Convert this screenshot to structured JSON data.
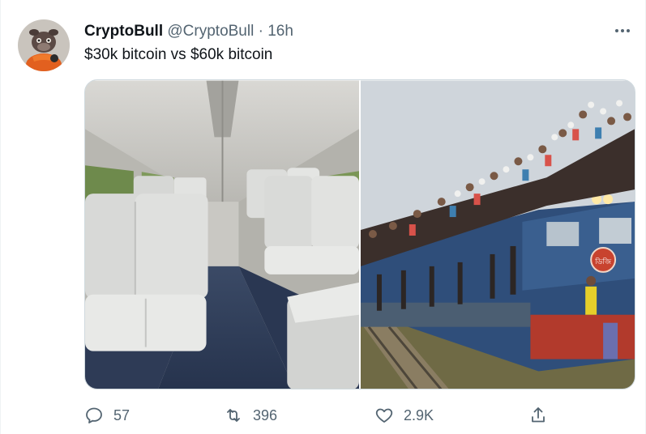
{
  "tweet": {
    "author_name": "CryptoBull",
    "author_handle": "@CryptoBull",
    "separator": "·",
    "time": "16h",
    "text": "$30k bitcoin vs $60k bitcoin"
  },
  "media": {
    "left_image": "empty-train-interior",
    "right_image": "overcrowded-train-with-people-on-roof",
    "train_badge_text": "ডিজি"
  },
  "actions": {
    "reply_count": "57",
    "retweet_count": "396",
    "like_count": "2.9K"
  },
  "colors": {
    "text_primary": "#0f1419",
    "text_secondary": "#536471",
    "border": "#cfd9de"
  },
  "icons": [
    "more-icon",
    "reply-icon",
    "retweet-icon",
    "like-icon",
    "share-icon"
  ]
}
